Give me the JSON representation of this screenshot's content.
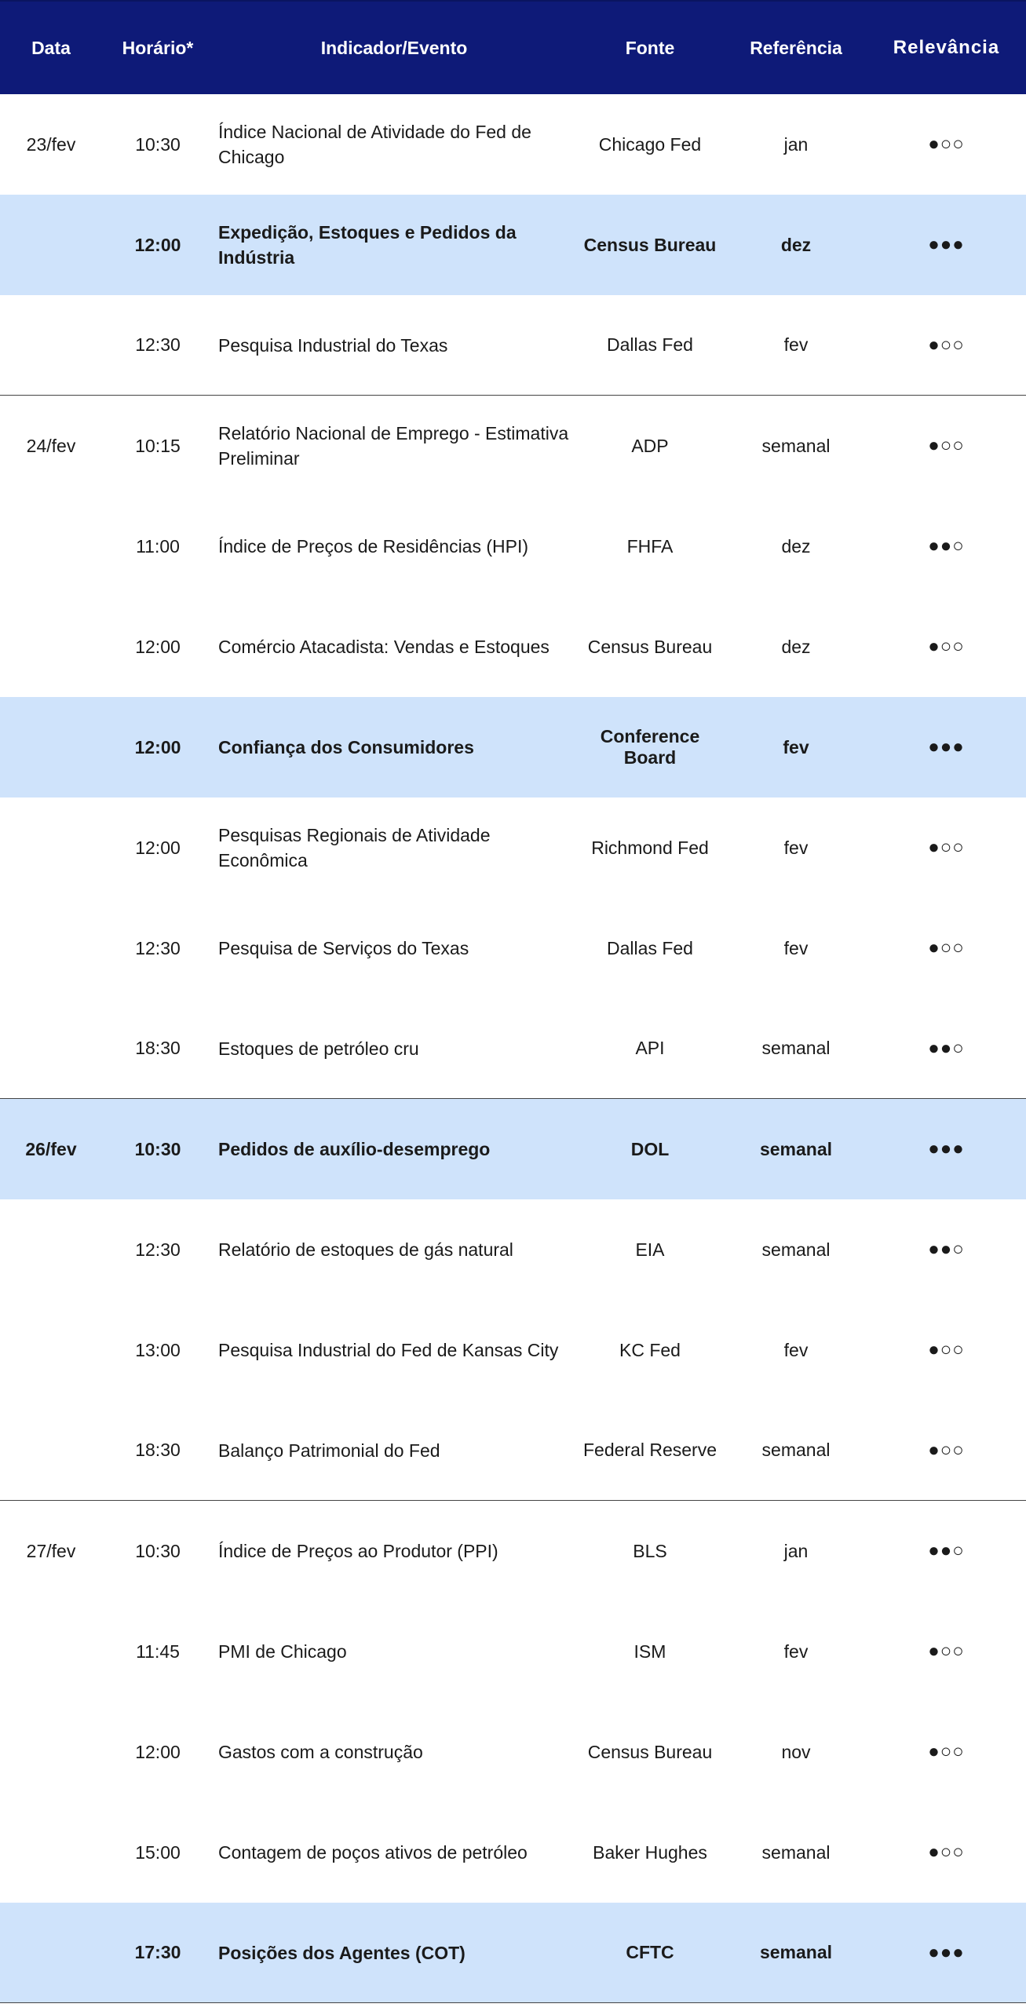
{
  "header": {
    "date": "Data",
    "time": "Horário*",
    "indicator": "Indicador/Evento",
    "source": "Fonte",
    "reference": "Referência",
    "relevance": "Relevância"
  },
  "rows": [
    {
      "date": "23/fev",
      "time": "10:30",
      "indicator": "Índice Nacional de Atividade do Fed de Chicago",
      "source": "Chicago Fed",
      "reference": "jan",
      "relevance": "●○○",
      "highlight": false,
      "group_end": false
    },
    {
      "date": "",
      "time": "12:00",
      "indicator": "Expedição, Estoques e Pedidos da Indústria",
      "source": "Census Bureau",
      "reference": "dez",
      "relevance": "●●●",
      "highlight": true,
      "group_end": false
    },
    {
      "date": "",
      "time": "12:30",
      "indicator": "Pesquisa Industrial do Texas",
      "source": "Dallas Fed",
      "reference": "fev",
      "relevance": "●○○",
      "highlight": false,
      "group_end": true
    },
    {
      "date": "24/fev",
      "time": "10:15",
      "indicator": "Relatório Nacional de Emprego - Estimativa Preliminar",
      "source": "ADP",
      "reference": "semanal",
      "relevance": "●○○",
      "highlight": false,
      "group_end": false
    },
    {
      "date": "",
      "time": "11:00",
      "indicator": "Índice de Preços de Residências (HPI)",
      "source": "FHFA",
      "reference": "dez",
      "relevance": "●●○",
      "highlight": false,
      "group_end": false
    },
    {
      "date": "",
      "time": "12:00",
      "indicator": "Comércio Atacadista: Vendas e Estoques",
      "source": "Census Bureau",
      "reference": "dez",
      "relevance": "●○○",
      "highlight": false,
      "group_end": false
    },
    {
      "date": "",
      "time": "12:00",
      "indicator": "Confiança dos Consumidores",
      "source": "Conference Board",
      "reference": "fev",
      "relevance": "●●●",
      "highlight": true,
      "group_end": false
    },
    {
      "date": "",
      "time": "12:00",
      "indicator": "Pesquisas Regionais de Atividade Econômica",
      "source": "Richmond Fed",
      "reference": "fev",
      "relevance": "●○○",
      "highlight": false,
      "group_end": false
    },
    {
      "date": "",
      "time": "12:30",
      "indicator": "Pesquisa de Serviços do Texas",
      "source": "Dallas Fed",
      "reference": "fev",
      "relevance": "●○○",
      "highlight": false,
      "group_end": false
    },
    {
      "date": "",
      "time": "18:30",
      "indicator": "Estoques de petróleo cru",
      "source": "API",
      "reference": "semanal",
      "relevance": "●●○",
      "highlight": false,
      "group_end": true
    },
    {
      "date": "26/fev",
      "time": "10:30",
      "indicator": "Pedidos de auxílio-desemprego",
      "source": "DOL",
      "reference": "semanal",
      "relevance": "●●●",
      "highlight": true,
      "group_end": false
    },
    {
      "date": "",
      "time": "12:30",
      "indicator": "Relatório de estoques de gás natural",
      "source": "EIA",
      "reference": "semanal",
      "relevance": "●●○",
      "highlight": false,
      "group_end": false
    },
    {
      "date": "",
      "time": "13:00",
      "indicator": "Pesquisa Industrial do Fed de Kansas City",
      "source": "KC Fed",
      "reference": "fev",
      "relevance": "●○○",
      "highlight": false,
      "group_end": false
    },
    {
      "date": "",
      "time": "18:30",
      "indicator": "Balanço Patrimonial do Fed",
      "source": "Federal Reserve",
      "reference": "semanal",
      "relevance": "●○○",
      "highlight": false,
      "group_end": true
    },
    {
      "date": "27/fev",
      "time": "10:30",
      "indicator": "Índice de Preços ao Produtor (PPI)",
      "source": "BLS",
      "reference": "jan",
      "relevance": "●●○",
      "highlight": false,
      "group_end": false
    },
    {
      "date": "",
      "time": "11:45",
      "indicator": "PMI de Chicago",
      "source": "ISM",
      "reference": "fev",
      "relevance": "●○○",
      "highlight": false,
      "group_end": false
    },
    {
      "date": "",
      "time": "12:00",
      "indicator": "Gastos com a construção",
      "source": "Census Bureau",
      "reference": "nov",
      "relevance": "●○○",
      "highlight": false,
      "group_end": false
    },
    {
      "date": "",
      "time": "15:00",
      "indicator": "Contagem de poços ativos de petróleo",
      "source": "Baker Hughes",
      "reference": "semanal",
      "relevance": "●○○",
      "highlight": false,
      "group_end": false
    },
    {
      "date": "",
      "time": "17:30",
      "indicator": "Posições dos Agentes (COT)",
      "source": "CFTC",
      "reference": "semanal",
      "relevance": "●●●",
      "highlight": true,
      "group_end": true
    }
  ]
}
